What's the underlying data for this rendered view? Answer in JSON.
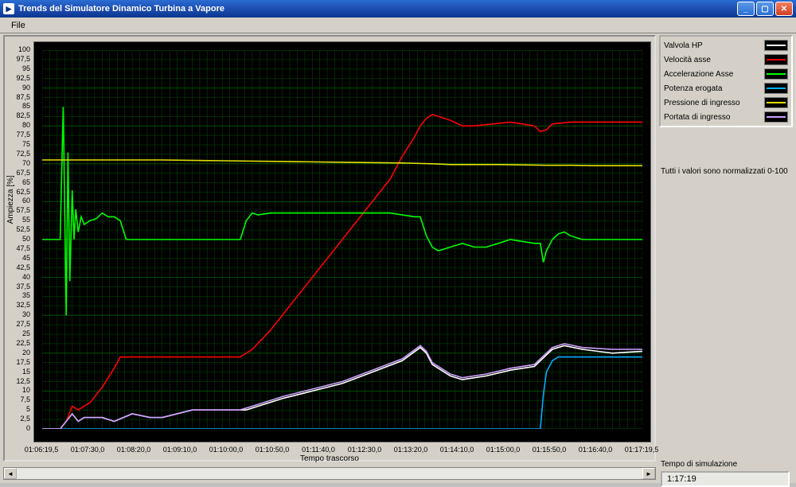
{
  "window": {
    "title": "Trends del Simulatore Dinamico Turbina a Vapore",
    "lv_icon": "▶"
  },
  "menu": {
    "file": "File"
  },
  "legend": {
    "items": [
      {
        "label": "Valvola HP",
        "color": "#ffffff"
      },
      {
        "label": "Velocità asse",
        "color": "#ff0000"
      },
      {
        "label": "Accelerazione Asse",
        "color": "#00ff00"
      },
      {
        "label": "Potenza erogata",
        "color": "#00b0ff"
      },
      {
        "label": "Pressione di ingresso",
        "color": "#e0e000"
      },
      {
        "label": "Portata di ingresso",
        "color": "#d0a0ff"
      }
    ]
  },
  "panel": {
    "norm_text": "Tutti i valori sono normalizzati 0-100",
    "sim_time_label": "Tempo di simulazione",
    "sim_time_value": "1:17:19"
  },
  "chart_data": {
    "type": "line",
    "title": "",
    "xlabel": "Tempo trascorso",
    "ylabel": "Ampiezza [%]",
    "ylim": [
      0,
      100
    ],
    "x_ticks": [
      "01:06:19,5",
      "01:07:30,0",
      "01:08:20,0",
      "01:09:10,0",
      "01:10:00,0",
      "01:10:50,0",
      "01:11:40,0",
      "01:12:30,0",
      "01:13:20,0",
      "01:14:10,0",
      "01:15:00,0",
      "01:15:50,0",
      "01:16:40,0",
      "01:17:19,5"
    ],
    "y_ticks": [
      0,
      2.5,
      5,
      7.5,
      10,
      12.5,
      15,
      17.5,
      20,
      22.5,
      25,
      27.5,
      30,
      32.5,
      35,
      37.5,
      40,
      42.5,
      45,
      47.5,
      50,
      52.5,
      55,
      57.5,
      60,
      62.5,
      65,
      67.5,
      70,
      72.5,
      75,
      77.5,
      80,
      82.5,
      85,
      87.5,
      90,
      92.5,
      95,
      97.5,
      100
    ],
    "grid": {
      "color": "#005000",
      "visible": true
    },
    "series": [
      {
        "name": "Valvola HP",
        "color": "#ffffff",
        "points": [
          [
            0,
            0
          ],
          [
            3,
            0
          ],
          [
            4,
            2
          ],
          [
            5,
            4
          ],
          [
            6,
            2
          ],
          [
            7,
            3
          ],
          [
            10,
            3
          ],
          [
            12,
            2
          ],
          [
            15,
            4
          ],
          [
            18,
            3
          ],
          [
            20,
            3
          ],
          [
            25,
            5
          ],
          [
            30,
            5
          ],
          [
            33,
            5
          ],
          [
            34,
            5
          ],
          [
            36,
            6
          ],
          [
            40,
            8
          ],
          [
            45,
            10
          ],
          [
            50,
            12
          ],
          [
            55,
            15
          ],
          [
            60,
            18
          ],
          [
            63,
            21.5
          ],
          [
            64,
            20
          ],
          [
            65,
            17
          ],
          [
            68,
            14
          ],
          [
            70,
            13
          ],
          [
            74,
            14
          ],
          [
            78,
            15.5
          ],
          [
            82,
            16.5
          ],
          [
            83,
            18
          ],
          [
            85,
            21
          ],
          [
            87,
            22
          ],
          [
            90,
            21
          ],
          [
            95,
            20
          ],
          [
            100,
            20.5
          ]
        ]
      },
      {
        "name": "Velocità asse",
        "color": "#ff0000",
        "points": [
          [
            0,
            0
          ],
          [
            3,
            0
          ],
          [
            4,
            2
          ],
          [
            5,
            6
          ],
          [
            6,
            5
          ],
          [
            8,
            7
          ],
          [
            10,
            11
          ],
          [
            12,
            16
          ],
          [
            13,
            19
          ],
          [
            14,
            19
          ],
          [
            20,
            19
          ],
          [
            25,
            19
          ],
          [
            30,
            19
          ],
          [
            33,
            19
          ],
          [
            35,
            21
          ],
          [
            38,
            26
          ],
          [
            42,
            34
          ],
          [
            46,
            42
          ],
          [
            50,
            50
          ],
          [
            54,
            58
          ],
          [
            58,
            66
          ],
          [
            60,
            72
          ],
          [
            62,
            77
          ],
          [
            63,
            80
          ],
          [
            64,
            82
          ],
          [
            65,
            83
          ],
          [
            66,
            82.5
          ],
          [
            68,
            81.5
          ],
          [
            70,
            80
          ],
          [
            72,
            80
          ],
          [
            75,
            80.5
          ],
          [
            78,
            81
          ],
          [
            80,
            80.5
          ],
          [
            82,
            80
          ],
          [
            83,
            78.5
          ],
          [
            84,
            79
          ],
          [
            85,
            80.5
          ],
          [
            88,
            81
          ],
          [
            92,
            81
          ],
          [
            96,
            81
          ],
          [
            100,
            81
          ]
        ]
      },
      {
        "name": "Accelerazione Asse",
        "color": "#00ff00",
        "points": [
          [
            0,
            50
          ],
          [
            3,
            50
          ],
          [
            3.5,
            85
          ],
          [
            4,
            30
          ],
          [
            4.3,
            73
          ],
          [
            4.6,
            39
          ],
          [
            5,
            63
          ],
          [
            5.3,
            50
          ],
          [
            5.6,
            58
          ],
          [
            6,
            52
          ],
          [
            6.5,
            56
          ],
          [
            7,
            54
          ],
          [
            8,
            55
          ],
          [
            9,
            55.5
          ],
          [
            10,
            57
          ],
          [
            11,
            56
          ],
          [
            12,
            56
          ],
          [
            13,
            55
          ],
          [
            14,
            50
          ],
          [
            16,
            50
          ],
          [
            20,
            50
          ],
          [
            25,
            50
          ],
          [
            30,
            50
          ],
          [
            32,
            50
          ],
          [
            33,
            50
          ],
          [
            34,
            55
          ],
          [
            35,
            57
          ],
          [
            36,
            56.5
          ],
          [
            38,
            57
          ],
          [
            42,
            57
          ],
          [
            46,
            57
          ],
          [
            50,
            57
          ],
          [
            55,
            57
          ],
          [
            58,
            57
          ],
          [
            60,
            56.5
          ],
          [
            62,
            56
          ],
          [
            63,
            56
          ],
          [
            64,
            51
          ],
          [
            65,
            48
          ],
          [
            66,
            47
          ],
          [
            68,
            48
          ],
          [
            70,
            49
          ],
          [
            72,
            48
          ],
          [
            74,
            48
          ],
          [
            76,
            49
          ],
          [
            78,
            50
          ],
          [
            80,
            49.5
          ],
          [
            82,
            49
          ],
          [
            83,
            49
          ],
          [
            83.5,
            44
          ],
          [
            84,
            47
          ],
          [
            85,
            50
          ],
          [
            86,
            51.5
          ],
          [
            87,
            52
          ],
          [
            88,
            51
          ],
          [
            90,
            50
          ],
          [
            93,
            50
          ],
          [
            96,
            50
          ],
          [
            100,
            50
          ]
        ]
      },
      {
        "name": "Potenza erogata",
        "color": "#00b0ff",
        "points": [
          [
            0,
            0
          ],
          [
            80,
            0
          ],
          [
            82,
            0
          ],
          [
            83,
            0
          ],
          [
            83.5,
            9
          ],
          [
            84,
            15
          ],
          [
            85,
            18
          ],
          [
            86,
            19
          ],
          [
            90,
            19
          ],
          [
            95,
            19
          ],
          [
            100,
            19
          ]
        ]
      },
      {
        "name": "Pressione di ingresso",
        "color": "#e0e000",
        "points": [
          [
            0,
            71
          ],
          [
            10,
            71
          ],
          [
            20,
            71
          ],
          [
            30,
            70.8
          ],
          [
            40,
            70.6
          ],
          [
            50,
            70.4
          ],
          [
            60,
            70.2
          ],
          [
            65,
            70
          ],
          [
            68,
            69.8
          ],
          [
            72,
            69.8
          ],
          [
            76,
            69.8
          ],
          [
            80,
            69.7
          ],
          [
            84,
            69.6
          ],
          [
            88,
            69.6
          ],
          [
            92,
            69.5
          ],
          [
            96,
            69.5
          ],
          [
            100,
            69.5
          ]
        ]
      },
      {
        "name": "Portata di ingresso",
        "color": "#d0a0ff",
        "points": [
          [
            0,
            0
          ],
          [
            3,
            0
          ],
          [
            4,
            2
          ],
          [
            5,
            4
          ],
          [
            6,
            2
          ],
          [
            7,
            3
          ],
          [
            10,
            3
          ],
          [
            12,
            2
          ],
          [
            15,
            4
          ],
          [
            18,
            3
          ],
          [
            20,
            3
          ],
          [
            25,
            5
          ],
          [
            30,
            5
          ],
          [
            33,
            5
          ],
          [
            34,
            5.5
          ],
          [
            36,
            6.5
          ],
          [
            40,
            8.5
          ],
          [
            45,
            10.5
          ],
          [
            50,
            12.5
          ],
          [
            55,
            15.5
          ],
          [
            60,
            18.5
          ],
          [
            63,
            22
          ],
          [
            64,
            20.5
          ],
          [
            65,
            17.5
          ],
          [
            68,
            14.5
          ],
          [
            70,
            13.5
          ],
          [
            74,
            14.5
          ],
          [
            78,
            16
          ],
          [
            82,
            17
          ],
          [
            83,
            18.5
          ],
          [
            85,
            21.5
          ],
          [
            87,
            22.5
          ],
          [
            90,
            21.5
          ],
          [
            95,
            21
          ],
          [
            100,
            21
          ]
        ]
      }
    ]
  }
}
